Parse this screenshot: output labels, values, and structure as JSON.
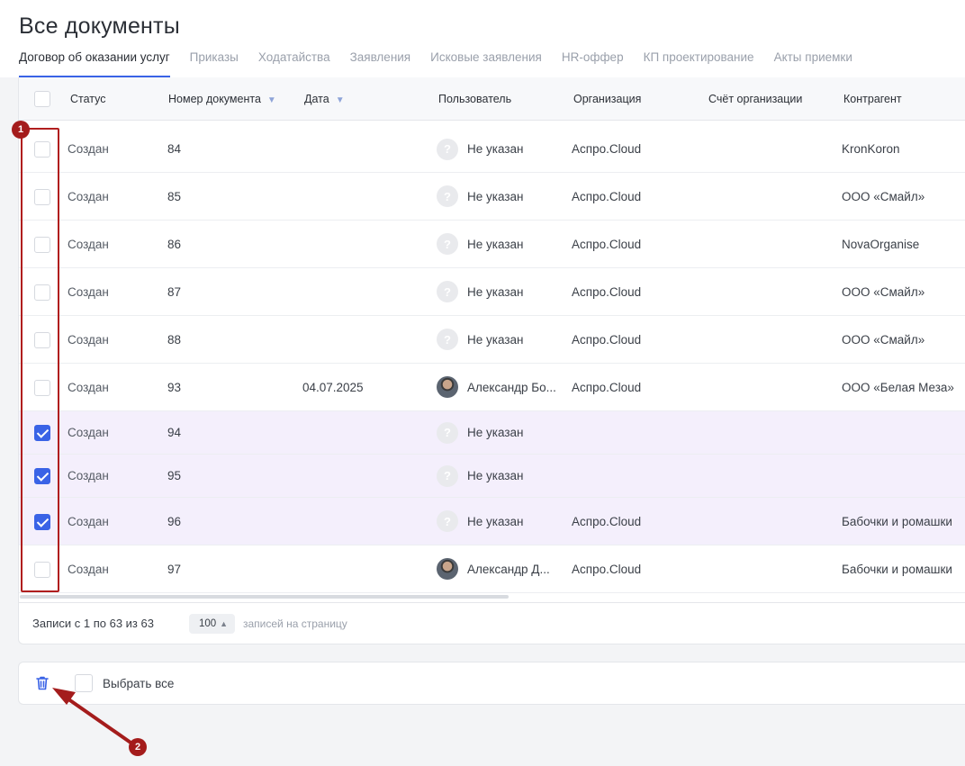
{
  "page": {
    "title": "Все документы"
  },
  "tabs": [
    {
      "label": "Договор об оказании услуг",
      "active": true
    },
    {
      "label": "Приказы"
    },
    {
      "label": "Ходатайства"
    },
    {
      "label": "Заявления"
    },
    {
      "label": "Исковые заявления"
    },
    {
      "label": "HR-оффер"
    },
    {
      "label": "КП проектирование"
    },
    {
      "label": "Акты приемки"
    }
  ],
  "table": {
    "headers": {
      "status": "Статус",
      "number": "Номер документа",
      "date": "Дата",
      "user": "Пользователь",
      "org": "Организация",
      "account": "Счёт организации",
      "contractor": "Контрагент"
    },
    "rows": [
      {
        "status": "Создан",
        "number": "84",
        "date": "",
        "user": "Не указан",
        "avatar": "placeholder",
        "org": "Аспро.Cloud",
        "contractor": "KronKoron",
        "checked": false
      },
      {
        "status": "Создан",
        "number": "85",
        "date": "",
        "user": "Не указан",
        "avatar": "placeholder",
        "org": "Аспро.Cloud",
        "contractor": "ООО «Смайл»",
        "checked": false
      },
      {
        "status": "Создан",
        "number": "86",
        "date": "",
        "user": "Не указан",
        "avatar": "placeholder",
        "org": "Аспро.Cloud",
        "contractor": "NovaOrganise",
        "checked": false
      },
      {
        "status": "Создан",
        "number": "87",
        "date": "",
        "user": "Не указан",
        "avatar": "placeholder",
        "org": "Аспро.Cloud",
        "contractor": "ООО «Смайл»",
        "checked": false
      },
      {
        "status": "Создан",
        "number": "88",
        "date": "",
        "user": "Не указан",
        "avatar": "placeholder",
        "org": "Аспро.Cloud",
        "contractor": "ООО «Смайл»",
        "checked": false
      },
      {
        "status": "Создан",
        "number": "93",
        "date": "04.07.2025",
        "user": "Александр Бо...",
        "avatar": "photo",
        "org": "Аспро.Cloud",
        "contractor": "ООО «Белая Меза»",
        "checked": false
      },
      {
        "status": "Создан",
        "number": "94",
        "date": "",
        "user": "Не указан",
        "avatar": "placeholder",
        "org": "",
        "contractor": "",
        "checked": true
      },
      {
        "status": "Создан",
        "number": "95",
        "date": "",
        "user": "Не указан",
        "avatar": "placeholder",
        "org": "",
        "contractor": "",
        "checked": true
      },
      {
        "status": "Создан",
        "number": "96",
        "date": "",
        "user": "Не указан",
        "avatar": "placeholder",
        "org": "Аспро.Cloud",
        "contractor": "Бабочки и ромашки",
        "checked": true
      },
      {
        "status": "Создан",
        "number": "97",
        "date": "",
        "user": "Александр Д...",
        "avatar": "photo",
        "org": "Аспро.Cloud",
        "contractor": "Бабочки и ромашки",
        "checked": false
      }
    ]
  },
  "pagination": {
    "records_text": "Записи с 1 по 63 из 63",
    "per_page_value": "100",
    "per_page_label": "записей на страницу"
  },
  "bulk": {
    "select_all_label": "Выбрать все"
  },
  "annotations": {
    "marker1": "1",
    "marker2": "2",
    "color": "#a41c1c"
  },
  "icons": {
    "avatar_placeholder": "?",
    "sort": "chevron-down-icon",
    "per_page": "chevron-up-icon",
    "delete": "trash-icon"
  },
  "colors": {
    "accent": "#3a63e6",
    "selected_row": "#f4effc",
    "annotation": "#a41c1c"
  }
}
